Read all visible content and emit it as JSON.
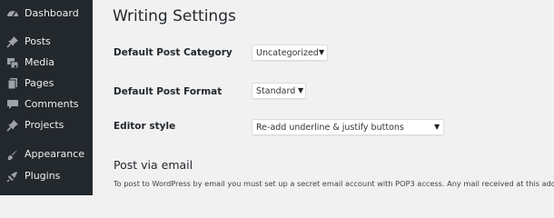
{
  "sidebar": {
    "items": [
      {
        "label": "Dashboard",
        "icon": "dashboard-icon"
      },
      {
        "label": "Posts",
        "icon": "pushpin-icon"
      },
      {
        "label": "Media",
        "icon": "media-icon"
      },
      {
        "label": "Pages",
        "icon": "pages-icon"
      },
      {
        "label": "Comments",
        "icon": "comment-icon"
      },
      {
        "label": "Projects",
        "icon": "pushpin-icon"
      },
      {
        "label": "Appearance",
        "icon": "brush-icon"
      },
      {
        "label": "Plugins",
        "icon": "plugin-icon"
      }
    ]
  },
  "page": {
    "title": "Writing Settings"
  },
  "settings": {
    "default_category": {
      "label": "Default Post Category",
      "value": "Uncategorized"
    },
    "default_format": {
      "label": "Default Post Format",
      "value": "Standard"
    },
    "editor_style": {
      "label": "Editor style",
      "value": "Re-add underline & justify buttons"
    }
  },
  "post_via_email": {
    "heading": "Post via email",
    "description": "To post to WordPress by email you must set up a secret email account with POP3 access. Any mail received at this address"
  },
  "colors": {
    "sidebar_bg": "#23282d",
    "sidebar_text": "#eeeeee",
    "icon": "#9ea3a8",
    "page_bg": "#f1f1f1"
  }
}
